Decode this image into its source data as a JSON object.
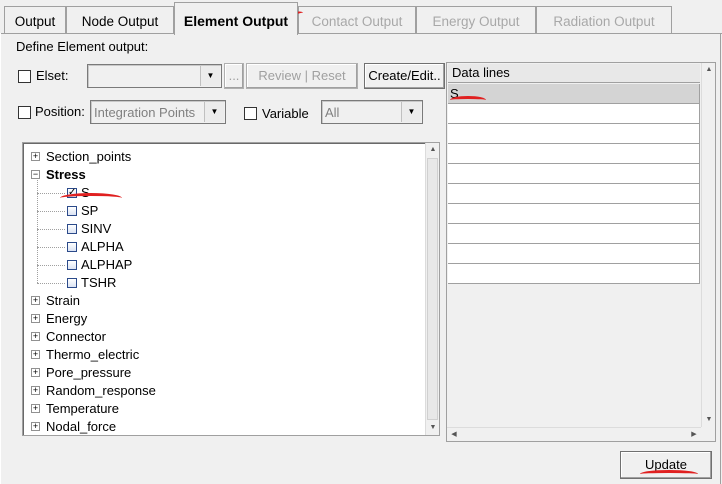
{
  "tabs": [
    {
      "label": "Output",
      "state": "normal"
    },
    {
      "label": "Node Output",
      "state": "normal"
    },
    {
      "label": "Element Output",
      "state": "active"
    },
    {
      "label": "Contact Output",
      "state": "disabled"
    },
    {
      "label": "Energy Output",
      "state": "disabled"
    },
    {
      "label": "Radiation Output",
      "state": "disabled"
    }
  ],
  "section_label": "Define Element output:",
  "elset": {
    "label": "Elset:",
    "value": "",
    "browse_label": "...",
    "review_label": "Review | Reset",
    "create_label": "Create/Edit.."
  },
  "position": {
    "label": "Position:",
    "value": "Integration Points"
  },
  "variable": {
    "label": "Variable",
    "value": "All"
  },
  "tree": {
    "groups": [
      {
        "label": "Section_points",
        "expanded": false
      },
      {
        "label": "Stress",
        "expanded": true,
        "bold": true,
        "children": [
          {
            "label": "S",
            "checked": true
          },
          {
            "label": "SP",
            "checked": false
          },
          {
            "label": "SINV",
            "checked": false
          },
          {
            "label": "ALPHA",
            "checked": false
          },
          {
            "label": "ALPHAP",
            "checked": false
          },
          {
            "label": "TSHR",
            "checked": false
          }
        ]
      },
      {
        "label": "Strain",
        "expanded": false
      },
      {
        "label": "Energy",
        "expanded": false
      },
      {
        "label": "Connector",
        "expanded": false
      },
      {
        "label": "Thermo_electric",
        "expanded": false
      },
      {
        "label": "Pore_pressure",
        "expanded": false
      },
      {
        "label": "Random_response",
        "expanded": false
      },
      {
        "label": "Temperature",
        "expanded": false
      },
      {
        "label": "Nodal_force",
        "expanded": false
      }
    ]
  },
  "data_lines": {
    "header": "Data lines",
    "rows": [
      "S.",
      "",
      "",
      "",
      "",
      "",
      "",
      "",
      "",
      ""
    ]
  },
  "update_label": "Update",
  "colors": {
    "annotation_red": "#e02020",
    "selected_row": "#d4d4d4"
  }
}
